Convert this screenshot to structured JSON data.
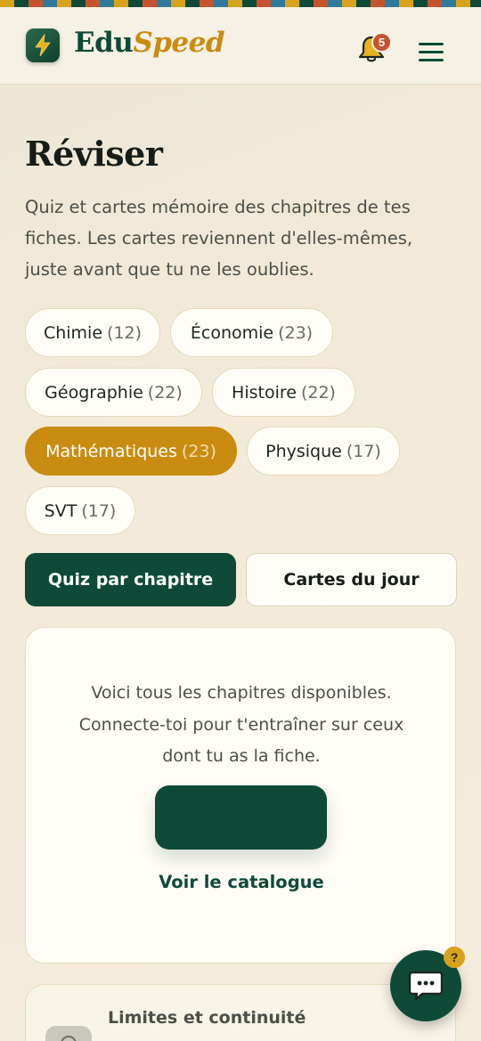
{
  "header": {
    "brand_primary": "Edu",
    "brand_secondary": "Speed",
    "notification_count": "5",
    "logo_icon": "lightning-bolt-icon",
    "bell_icon": "bell-icon",
    "menu_icon": "hamburger-menu-icon"
  },
  "page": {
    "title": "Réviser",
    "intro": "Quiz et cartes mémoire des chapitres de tes fiches. Les cartes reviennent d'elles-mêmes, juste avant que tu ne les oublies."
  },
  "subjects": [
    {
      "name": "Chimie",
      "count": "(12)",
      "active": false
    },
    {
      "name": "Économie",
      "count": "(23)",
      "active": false
    },
    {
      "name": "Géographie",
      "count": "(22)",
      "active": false
    },
    {
      "name": "Histoire",
      "count": "(22)",
      "active": false
    },
    {
      "name": "Mathématiques",
      "count": "(23)",
      "active": true
    },
    {
      "name": "Physique",
      "count": "(17)",
      "active": false
    },
    {
      "name": "SVT",
      "count": "(17)",
      "active": false
    }
  ],
  "modes": {
    "quiz_label": "Quiz par chapitre",
    "cards_label": "Cartes du jour"
  },
  "notice": {
    "text": "Voici tous les chapitres disponibles. Connecte-toi pour t'entraîner sur ceux dont tu as la fiche.",
    "catalog_link": "Voir le catalogue"
  },
  "chapters": [
    {
      "title": "Limites et continuité"
    }
  ],
  "help": {
    "badge": "?",
    "chat_icon": "chat-bubble-icon"
  },
  "colors": {
    "brand_green": "#0f4a38",
    "brand_gold": "#c98c11",
    "badge_red": "#c7532d"
  }
}
